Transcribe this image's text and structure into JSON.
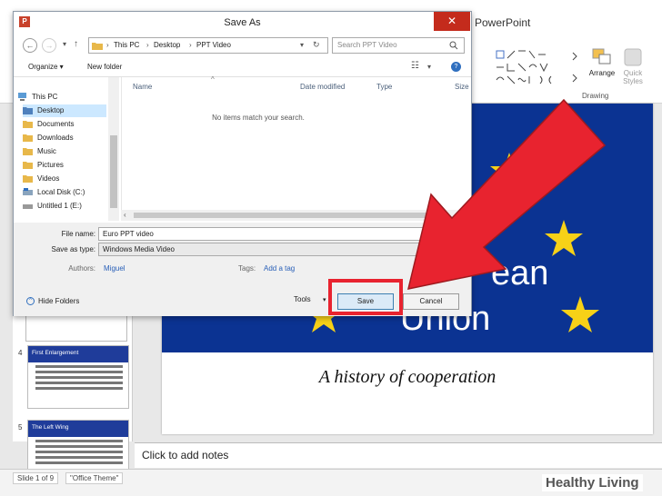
{
  "app": {
    "title_suffix": "PowerPoint"
  },
  "ribbon": {
    "arrange_label": "Arrange",
    "quick_styles_label": "Quick Styles",
    "group_label": "Drawing"
  },
  "thumbnails": [
    {
      "number": "4",
      "title": "First Enlargement"
    },
    {
      "number": "5",
      "title": "The Left Wing"
    }
  ],
  "slide": {
    "line1": "ean",
    "line2": "Union",
    "subtitle": "A history of cooperation",
    "colors": {
      "background": "#0b3392",
      "star": "#f7d117"
    }
  },
  "notes": {
    "placeholder": "Click to add notes"
  },
  "status": {
    "slide": "Slide 1 of 9",
    "theme": "\"Office Theme\""
  },
  "watermark": "Healthy Living",
  "dialog": {
    "title": "Save As",
    "breadcrumb": [
      "This PC",
      "Desktop",
      "PPT Video"
    ],
    "search_placeholder": "Search PPT Video",
    "toolbar": {
      "organize": "Organize ▾",
      "new_folder": "New folder"
    },
    "tree": [
      {
        "label": "This PC",
        "icon": "computer-icon"
      },
      {
        "label": "Desktop",
        "icon": "folder-icon",
        "selected": true
      },
      {
        "label": "Documents",
        "icon": "folder-icon"
      },
      {
        "label": "Downloads",
        "icon": "folder-icon"
      },
      {
        "label": "Music",
        "icon": "folder-icon"
      },
      {
        "label": "Pictures",
        "icon": "folder-icon"
      },
      {
        "label": "Videos",
        "icon": "folder-icon"
      },
      {
        "label": "Local Disk (C:)",
        "icon": "drive-icon"
      },
      {
        "label": "Untitled 1 (E:)",
        "icon": "drive-icon"
      }
    ],
    "columns": [
      "Name",
      "Date modified",
      "Type",
      "Size"
    ],
    "empty_message": "No items match your search.",
    "form": {
      "file_name_label": "File name:",
      "file_name_value": "Euro PPT video",
      "save_type_label": "Save as type:",
      "save_type_value": "Windows Media Video",
      "authors_label": "Authors:",
      "authors_value": "Miguel",
      "tags_label": "Tags:",
      "tags_value": "Add a tag"
    },
    "buttons": {
      "hide_folders": "Hide Folders",
      "tools": "Tools",
      "save": "Save",
      "cancel": "Cancel"
    }
  },
  "annotation_colors": {
    "arrow": "#e8232f",
    "highlight": "#e8232f"
  }
}
